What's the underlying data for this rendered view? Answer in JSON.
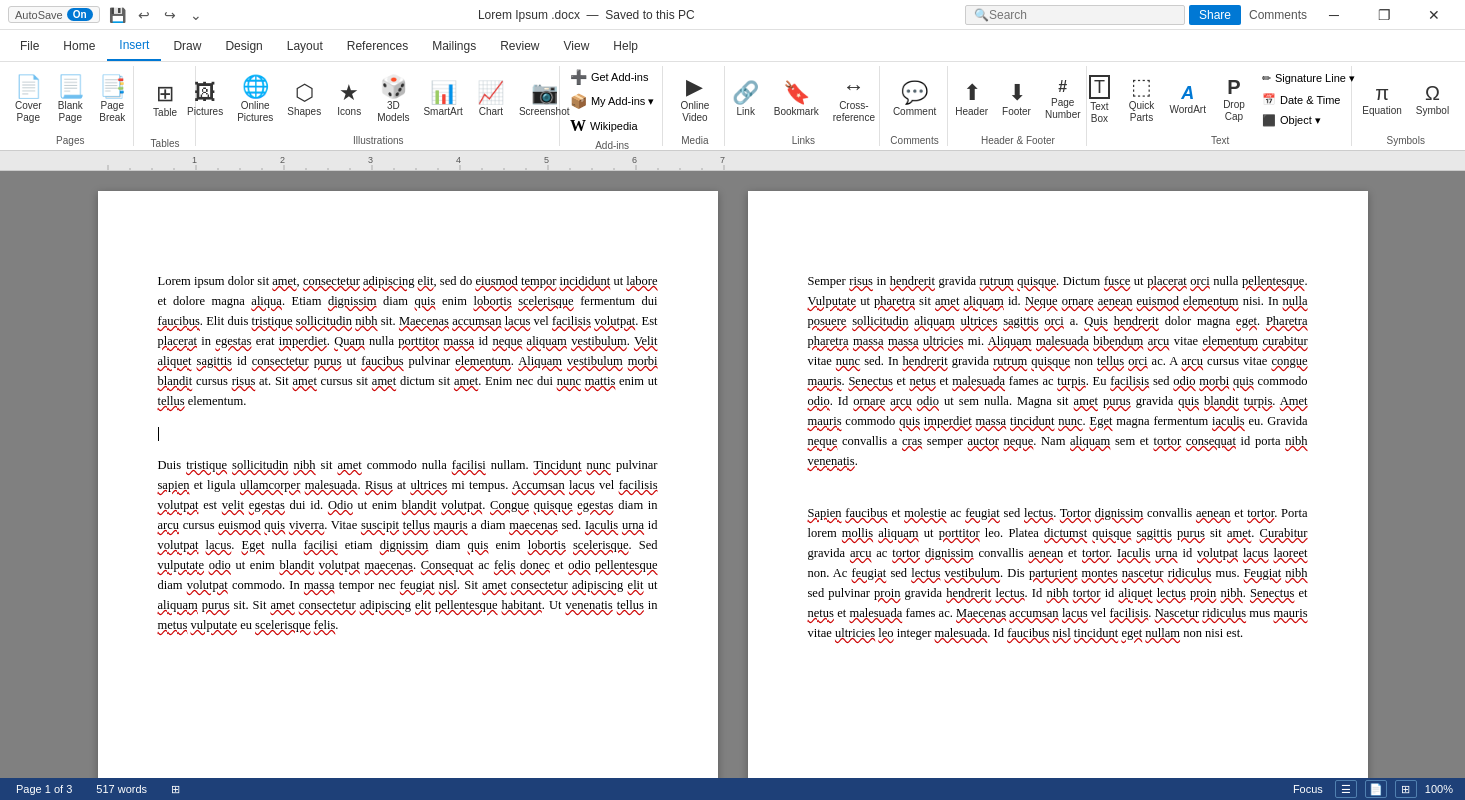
{
  "titlebar": {
    "autosave": "AutoSave",
    "autosave_state": "On",
    "save_icon": "💾",
    "undo_icon": "↩",
    "redo_icon": "↪",
    "doc_title": "Lorem Ipsum .docx",
    "saved_state": "Saved to this PC",
    "search_placeholder": "Search",
    "share_label": "Share",
    "comments_label": "Comments",
    "minimize_icon": "─",
    "restore_icon": "❐",
    "close_icon": "✕"
  },
  "ribbon": {
    "tabs": [
      {
        "id": "file",
        "label": "File"
      },
      {
        "id": "home",
        "label": "Home"
      },
      {
        "id": "insert",
        "label": "Insert"
      },
      {
        "id": "draw",
        "label": "Draw"
      },
      {
        "id": "design",
        "label": "Design"
      },
      {
        "id": "layout",
        "label": "Layout"
      },
      {
        "id": "references",
        "label": "References"
      },
      {
        "id": "mailings",
        "label": "Mailings"
      },
      {
        "id": "review",
        "label": "Review"
      },
      {
        "id": "view",
        "label": "View"
      },
      {
        "id": "help",
        "label": "Help"
      }
    ],
    "active_tab": "insert",
    "groups": [
      {
        "id": "pages",
        "label": "Pages",
        "items": [
          {
            "id": "cover-page",
            "label": "Cover\nPage",
            "icon": "📄"
          },
          {
            "id": "blank-page",
            "label": "Blank\nPage",
            "icon": "📃"
          },
          {
            "id": "page-break",
            "label": "Page\nBreak",
            "icon": "📑"
          }
        ]
      },
      {
        "id": "tables",
        "label": "Tables",
        "items": [
          {
            "id": "table",
            "label": "Table",
            "icon": "⊞"
          }
        ]
      },
      {
        "id": "illustrations",
        "label": "Illustrations",
        "items": [
          {
            "id": "pictures",
            "label": "Pictures",
            "icon": "🖼"
          },
          {
            "id": "online-pictures",
            "label": "Online\nPictures",
            "icon": "🌐"
          },
          {
            "id": "shapes",
            "label": "Shapes",
            "icon": "⬡"
          },
          {
            "id": "icons",
            "label": "Icons",
            "icon": "★"
          },
          {
            "id": "3d-models",
            "label": "3D\nModels",
            "icon": "🎲"
          },
          {
            "id": "smartart",
            "label": "SmartArt",
            "icon": "📊"
          },
          {
            "id": "chart",
            "label": "Chart",
            "icon": "📈"
          },
          {
            "id": "screenshot",
            "label": "Screenshot",
            "icon": "📷"
          }
        ]
      },
      {
        "id": "add-ins",
        "label": "Add-ins",
        "items": [
          {
            "id": "get-add-ins",
            "label": "Get Add-ins",
            "icon": "➕"
          },
          {
            "id": "my-add-ins",
            "label": "My Add-ins",
            "icon": "📦"
          },
          {
            "id": "wikipedia",
            "label": "Wikipedia",
            "icon": "W"
          }
        ]
      },
      {
        "id": "media",
        "label": "Media",
        "items": [
          {
            "id": "online-video",
            "label": "Online\nVideo",
            "icon": "▶"
          }
        ]
      },
      {
        "id": "links",
        "label": "Links",
        "items": [
          {
            "id": "link",
            "label": "Link",
            "icon": "🔗"
          },
          {
            "id": "bookmark",
            "label": "Bookmark",
            "icon": "🔖"
          },
          {
            "id": "cross-ref",
            "label": "Cross-\nreference",
            "icon": "↔"
          }
        ]
      },
      {
        "id": "comments",
        "label": "Comments",
        "items": [
          {
            "id": "comment",
            "label": "Comment",
            "icon": "💬"
          }
        ]
      },
      {
        "id": "header-footer",
        "label": "Header & Footer",
        "items": [
          {
            "id": "header",
            "label": "Header",
            "icon": "⬆"
          },
          {
            "id": "footer",
            "label": "Footer",
            "icon": "⬇"
          },
          {
            "id": "page-number",
            "label": "Page\nNumber",
            "icon": "#"
          }
        ]
      },
      {
        "id": "text",
        "label": "Text",
        "items": [
          {
            "id": "text-box",
            "label": "Text\nBox",
            "icon": "T"
          },
          {
            "id": "quick-parts",
            "label": "Quick\nParts",
            "icon": "⬚"
          },
          {
            "id": "wordart",
            "label": "WordArt",
            "icon": "A"
          },
          {
            "id": "drop-cap",
            "label": "Drop\nCap",
            "icon": "P"
          },
          {
            "id": "signature-line",
            "label": "Signature Line",
            "icon": "✏"
          },
          {
            "id": "date-time",
            "label": "Date & Time",
            "icon": "📅"
          },
          {
            "id": "object",
            "label": "Object",
            "icon": "⬛"
          }
        ]
      },
      {
        "id": "symbols",
        "label": "Symbols",
        "items": [
          {
            "id": "equation",
            "label": "Equation",
            "icon": "π"
          },
          {
            "id": "symbol",
            "label": "Symbol",
            "icon": "Ω"
          }
        ]
      }
    ]
  },
  "document": {
    "page1": {
      "paragraph1": "Lorem ipsum dolor sit amet, consectetur adipiscing elit, sed do eiusmod tempor incididunt ut labore et dolore magna aliqua. Etiam dignissim diam quis enim lobortis scelerisque fermentum dui faucibus. Elit duis tristique sollicitudin nibh sit. Maecenas accumsan lacus vel facilisis volutpat. Est placerat in egestas erat imperdiet. Quam nulla porttitor massa id neque aliquam vestibulum. Velit aliquet sagittis id consectetur purus ut faucibus pulvinar elementum. Aliquam vestibulum morbi blandit cursus risus at. Sit amet cursus sit amet dictum sit amet. Enim nec dui nunc mattis enim ut tellus elementum.",
      "paragraph2": "Duis tristique sollicitudin nibh sit amet commodo nulla facilisi nullam. Tincidunt nunc pulvinar sapien et ligula ullamcorper malesuada. Risus at ultrices mi tempus. Accumsan lacus vel facilisis volutpat est velit egestas dui id. Odio ut enim blandit volutpat. Congue quisque egestas diam in arcu cursus euismod quis viverra. Vitae suscipit tellus mauris a diam maecenas sed. Iaculis urna id volutpat lacus. Eget nulla facilisi etiam dignissim diam quis enim lobortis scelerisque. Sed vulputate odio ut enim blandit volutpat maecenas. Consequat ac felis donec et odio pellentesque diam volutpat commodo. In massa tempor nec feugiat nisl. Sit amet consectetur adipiscing elit ut aliquam purus sit. Sit amet consectetur adipiscing elit pellentesque habitant. Ut venenatis tellus in metus vulputate eu scelerisque felis."
    },
    "page2": {
      "paragraph1": "Semper risus in hendrerit gravida rutrum quisque. Dictum fusce ut placerat orci nulla pellentesque. Vulputate ut pharetra sit amet aliquam id. Neque ornare aenean euismod elementum nisi. In nulla posuere sollicitudin aliquam ultrices sagittis orci a. Quis hendrerit dolor magna eget. Pharetra pharetra massa massa ultricies mi. Aliquam malesuada bibendum arcu vitae elementum curabitur vitae nunc sed. In hendrerit gravida rutrum quisque non tellus orci ac. A arcu cursus vitae congue mauris. Senectus et netus et malesuada fames ac turpis. Eu facilisis sed odio morbi quis commodo odio. Id ornare arcu odio ut sem nulla. Magna sit amet purus gravida quis blandit turpis. Amet mauris commodo quis imperdiet massa tincidunt nunc. Eget magna fermentum iaculis eu. Gravida neque convallis a cras semper auctor neque. Nam aliquam sem et tortor consequat id porta nibh venenatis.",
      "paragraph2": "Sapien faucibus et molestie ac feugiat sed lectus. Tortor dignissim convallis aenean et tortor. Porta lorem mollis aliquam ut porttitor leo. Platea dictumst quisque sagittis purus sit amet. Curabitur gravida arcu ac tortor dignissim convallis aenean et tortor. Iaculis urna id volutpat lacus laoreet non. Ac feugiat sed lectus vestibulum. Dis parturient montes nascetur ridiculus mus. Feugiat nibh sed pulvinar proin gravida hendrerit lectus. Id nibh tortor id aliquet lectus proin nibh. Senectus et netus et malesuada fames ac. Maecenas accumsan lacus vel facilisis. Nascetur ridiculus mus mauris vitae ultricies leo integer malesuada. Id faucibus nisl tincidunt eget nullam non nisi est."
    }
  },
  "statusbar": {
    "page_info": "Page 1 of 3",
    "word_count": "517 words",
    "language_icon": "⊞",
    "focus_label": "Focus",
    "view_icons": [
      "≡",
      "📄",
      "⊞"
    ],
    "zoom": "100%"
  }
}
